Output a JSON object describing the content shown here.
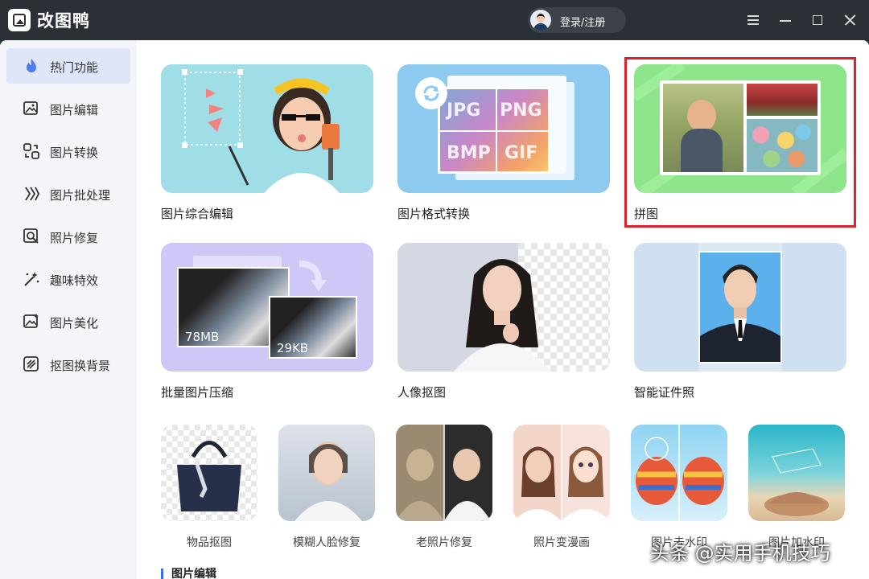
{
  "app": {
    "title": "改图鸭",
    "login": "登录/注册"
  },
  "sidebar": {
    "items": [
      {
        "label": "热门功能",
        "icon": "flame-icon",
        "active": true
      },
      {
        "label": "图片编辑",
        "icon": "image-edit-icon"
      },
      {
        "label": "图片转换",
        "icon": "convert-icon"
      },
      {
        "label": "图片批处理",
        "icon": "batch-icon"
      },
      {
        "label": "照片修复",
        "icon": "photo-repair-icon"
      },
      {
        "label": "趣味特效",
        "icon": "magic-wand-icon"
      },
      {
        "label": "图片美化",
        "icon": "beautify-icon"
      },
      {
        "label": "抠图换背景",
        "icon": "cutout-icon"
      }
    ]
  },
  "main": {
    "features": [
      {
        "label": "图片综合编辑"
      },
      {
        "label": "图片格式转换",
        "formats": [
          "JPG",
          "PNG",
          "BMP",
          "GIF"
        ]
      },
      {
        "label": "拼图"
      },
      {
        "label": "批量图片压缩",
        "before": "78MB",
        "after": "29KB"
      },
      {
        "label": "人像抠图"
      },
      {
        "label": "智能证件照"
      }
    ],
    "small_features": [
      {
        "label": "物品抠图"
      },
      {
        "label": "模糊人脸修复"
      },
      {
        "label": "老照片修复"
      },
      {
        "label": "照片变漫画"
      },
      {
        "label": "图片去水印"
      },
      {
        "label": "图片加水印"
      }
    ],
    "section_title": "图片编辑"
  },
  "watermark": "头条 @实用手机技巧",
  "colors": {
    "titlebar": "#2b2f36",
    "accent": "#3b6cf2",
    "highlight": "#d9252b",
    "sidebar_active": "#dfe6f8"
  }
}
